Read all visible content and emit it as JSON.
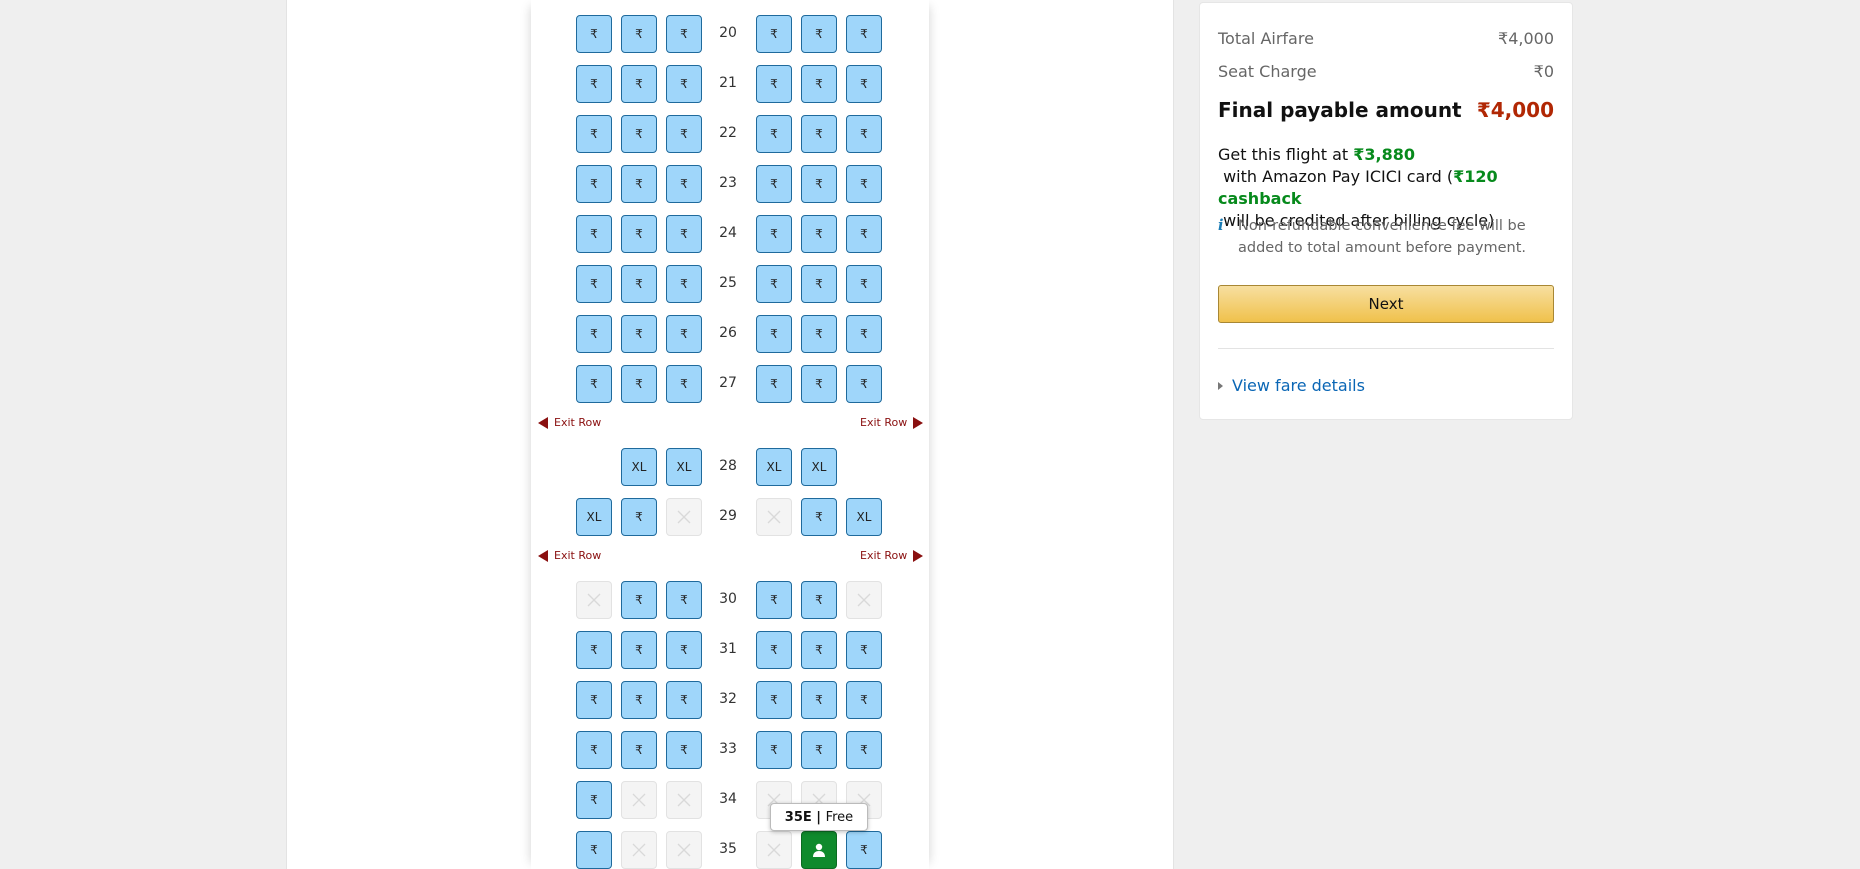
{
  "seatmap": {
    "rows": [
      {
        "num": "20",
        "seats": [
          "R",
          "R",
          "R",
          "R",
          "R",
          "R"
        ]
      },
      {
        "num": "21",
        "seats": [
          "R",
          "R",
          "R",
          "R",
          "R",
          "R"
        ]
      },
      {
        "num": "22",
        "seats": [
          "R",
          "R",
          "R",
          "R",
          "R",
          "R"
        ]
      },
      {
        "num": "23",
        "seats": [
          "R",
          "R",
          "R",
          "R",
          "R",
          "R"
        ]
      },
      {
        "num": "24",
        "seats": [
          "R",
          "R",
          "R",
          "R",
          "R",
          "R"
        ]
      },
      {
        "num": "25",
        "seats": [
          "R",
          "R",
          "R",
          "R",
          "R",
          "R"
        ]
      },
      {
        "num": "26",
        "seats": [
          "R",
          "R",
          "R",
          "R",
          "R",
          "R"
        ]
      },
      {
        "num": "27",
        "seats": [
          "R",
          "R",
          "R",
          "R",
          "R",
          "R"
        ]
      },
      {
        "exit": true
      },
      {
        "num": "28",
        "seats": [
          "-",
          "XL",
          "XL",
          "XL",
          "XL",
          "-"
        ]
      },
      {
        "num": "29",
        "seats": [
          "XL",
          "R",
          "B",
          "B",
          "R",
          "XL"
        ]
      },
      {
        "exit": true
      },
      {
        "num": "30",
        "seats": [
          "B",
          "R",
          "R",
          "R",
          "R",
          "B"
        ]
      },
      {
        "num": "31",
        "seats": [
          "R",
          "R",
          "R",
          "R",
          "R",
          "R"
        ]
      },
      {
        "num": "32",
        "seats": [
          "R",
          "R",
          "R",
          "R",
          "R",
          "R"
        ]
      },
      {
        "num": "33",
        "seats": [
          "R",
          "R",
          "R",
          "R",
          "R",
          "R"
        ]
      },
      {
        "num": "34",
        "seats": [
          "R",
          "B",
          "B",
          "B",
          "B",
          "B"
        ]
      },
      {
        "num": "35",
        "seats": [
          "R",
          "B",
          "B",
          "B",
          "S",
          "R"
        ]
      }
    ],
    "rupee_symbol": "₹",
    "xl_label": "XL",
    "exit_label": "Exit Row",
    "tooltip": {
      "seat": "35E",
      "sep": " | ",
      "price": "Free"
    },
    "colors": {
      "available": "#9fd6fa",
      "selected": "#0f8a2c",
      "blocked": "#f4f4f4"
    }
  },
  "summary": {
    "total_airfare_label": "Total Airfare",
    "total_airfare_value": "₹4,000",
    "seat_charge_label": "Seat Charge",
    "seat_charge_value": "₹0",
    "final_label": "Final payable amount",
    "final_value": "₹4,000",
    "offer_pre": "Get this flight at ",
    "offer_price": "₹3,880",
    "offer_mid": " with Amazon Pay ICICI card (",
    "offer_cashback": "₹120 cashback",
    "offer_post": " will be credited after billing cycle)",
    "info_icon": "i",
    "note": "Non-refundable convenience fee will be added to total amount before payment.",
    "next_label": "Next",
    "fare_link": "View fare details"
  }
}
